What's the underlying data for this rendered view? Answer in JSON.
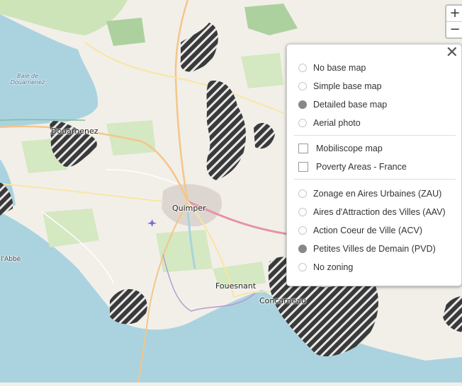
{
  "map": {
    "places": {
      "quimper": "Quimper",
      "fouesnant": "Fouesnant",
      "concarneau": "Concarneau",
      "douarnenez": "Douarnenez",
      "baie_line1": "Baie de",
      "baie_line2": "Douarnenez",
      "pont": "Pont-l'Abbé"
    },
    "colors": {
      "land": "#f2efe9",
      "water": "#aad3df",
      "forest": "#add19e",
      "hatch": "#3a3a3a"
    }
  },
  "zoom": {
    "in_label": "+",
    "out_label": "−"
  },
  "layers_panel": {
    "close_label": "✕",
    "base_maps": [
      {
        "label": "No base map",
        "selected": false
      },
      {
        "label": "Simple base map",
        "selected": false
      },
      {
        "label": "Detailed base map",
        "selected": true
      },
      {
        "label": "Aerial photo",
        "selected": false
      }
    ],
    "overlays": [
      {
        "label": "Mobiliscope map",
        "checked": false
      },
      {
        "label": "Poverty Areas - France",
        "checked": false
      }
    ],
    "zonings": [
      {
        "label": "Zonage en Aires Urbaines (ZAU)",
        "selected": false
      },
      {
        "label": "Aires d'Attraction des Villes (AAV)",
        "selected": false
      },
      {
        "label": "Action Coeur de Ville (ACV)",
        "selected": false
      },
      {
        "label": "Petites Villes de Demain (PVD)",
        "selected": true
      },
      {
        "label": "No zoning",
        "selected": false
      }
    ]
  }
}
